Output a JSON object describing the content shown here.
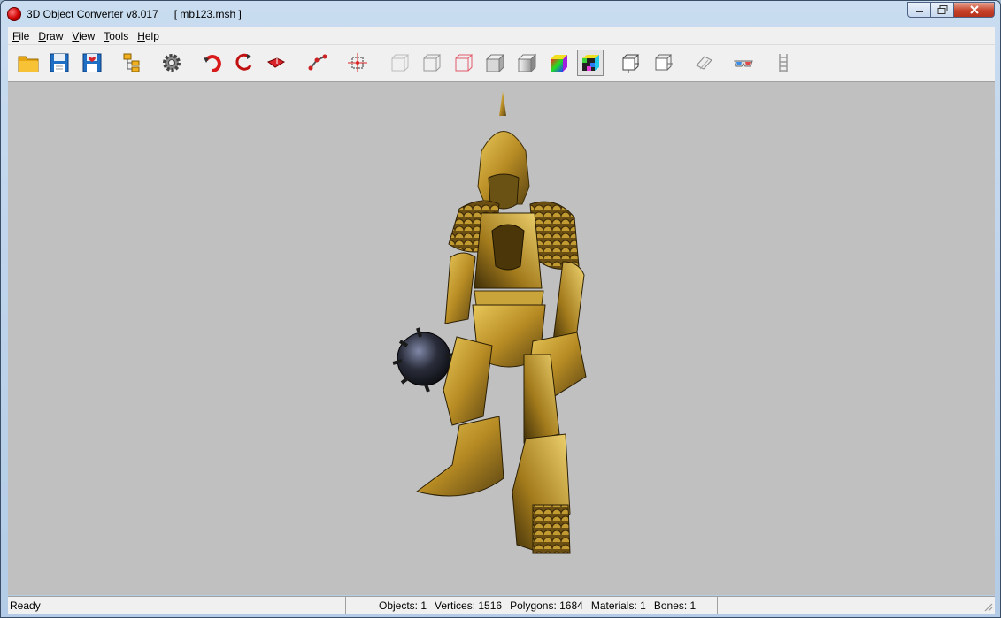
{
  "window": {
    "title": "3D Object Converter v8.017",
    "file": "[ mb123.msh ]"
  },
  "menu": [
    {
      "label_u": "F",
      "label_rest": "ile"
    },
    {
      "label_u": "D",
      "label_rest": "raw"
    },
    {
      "label_u": "V",
      "label_rest": "iew"
    },
    {
      "label_u": "T",
      "label_rest": "ools"
    },
    {
      "label_u": "H",
      "label_rest": "elp"
    }
  ],
  "toolbar": {
    "icons": [
      "open-folder-icon",
      "save-icon",
      "save-as-icon",
      "hierarchy-icon",
      "settings-gear-icon",
      "rotate-x-icon",
      "rotate-y-icon",
      "rotate-z-icon",
      "bone-link-icon",
      "pivot-icon",
      "wireframe-icon",
      "wireframe-hidden-icon",
      "wireframe-color-icon",
      "flat-shade-icon",
      "smooth-shade-icon",
      "vertex-color-icon",
      "texture-icon",
      "box-front-icon",
      "box-side-icon",
      "paper-icon",
      "glasses-3d-icon",
      "ladder-icon"
    ],
    "active": "texture-icon"
  },
  "status": {
    "ready": "Ready",
    "objects": "Objects: 1",
    "vertices": "Vertices: 1516",
    "polygons": "Polygons: 1684",
    "materials": "Materials: 1",
    "bones": "Bones: 1"
  },
  "colors": {
    "viewport_bg": "#c0c0c0",
    "armor_gold": "#c9a43a",
    "armor_dark": "#5a4412",
    "mace": "#2a2d3a"
  }
}
